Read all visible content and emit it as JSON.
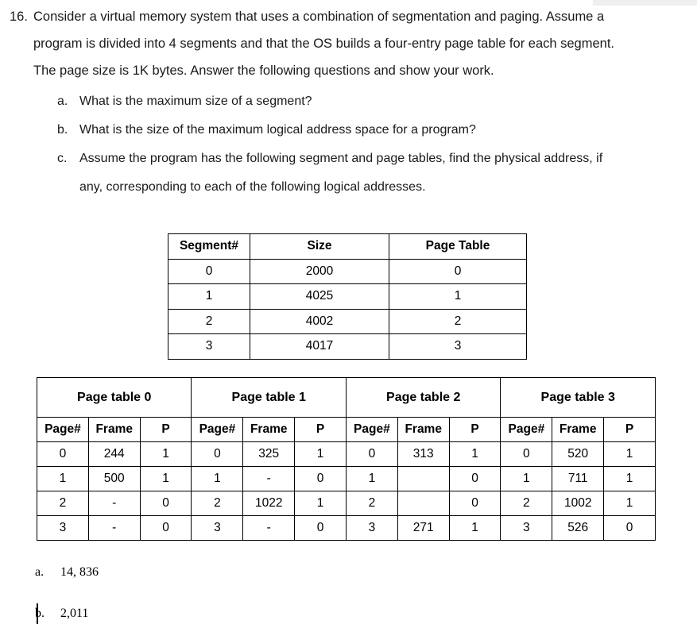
{
  "question": {
    "number": "16.",
    "line1": "Consider a virtual memory system that uses a combination of segmentation and paging. Assume a",
    "line2": "program is divided into 4 segments and that the OS builds a four-entry page table for each segment.",
    "line3": "The page size is 1K bytes. Answer the following questions and show your work.",
    "subparts": [
      {
        "label": "a.",
        "line1": "What is the maximum size of a segment?",
        "line2": ""
      },
      {
        "label": "b.",
        "line1": "What is the size of the maximum logical address space for a program?",
        "line2": ""
      },
      {
        "label": "c.",
        "line1": "Assume the program has the following segment and page tables, find the physical address, if",
        "line2": "any, corresponding to each of the following logical addresses."
      }
    ]
  },
  "segment_table": {
    "headers": [
      "Segment#",
      "Size",
      "Page Table"
    ],
    "rows": [
      [
        "0",
        "2000",
        "0"
      ],
      [
        "1",
        "4025",
        "1"
      ],
      [
        "2",
        "4002",
        "2"
      ],
      [
        "3",
        "4017",
        "3"
      ]
    ]
  },
  "page_tables": {
    "group_headers": [
      "Page table 0",
      "Page table 1",
      "Page table 2",
      "Page table 3"
    ],
    "sub_headers": [
      "Page#",
      "Frame",
      "P"
    ],
    "rows": [
      [
        "0",
        "244",
        "1",
        "0",
        "325",
        "1",
        "0",
        "313",
        "1",
        "0",
        "520",
        "1"
      ],
      [
        "1",
        "500",
        "1",
        "1",
        "-",
        "0",
        "1",
        "",
        "0",
        "1",
        "711",
        "1"
      ],
      [
        "2",
        "-",
        "0",
        "2",
        "1022",
        "1",
        "2",
        "",
        "0",
        "2",
        "1002",
        "1"
      ],
      [
        "3",
        "-",
        "0",
        "3",
        "-",
        "0",
        "3",
        "271",
        "1",
        "3",
        "526",
        "0"
      ]
    ]
  },
  "answers": [
    {
      "label": "a.",
      "value": "14, 836"
    },
    {
      "label": "b.",
      "value": "2,011"
    }
  ]
}
